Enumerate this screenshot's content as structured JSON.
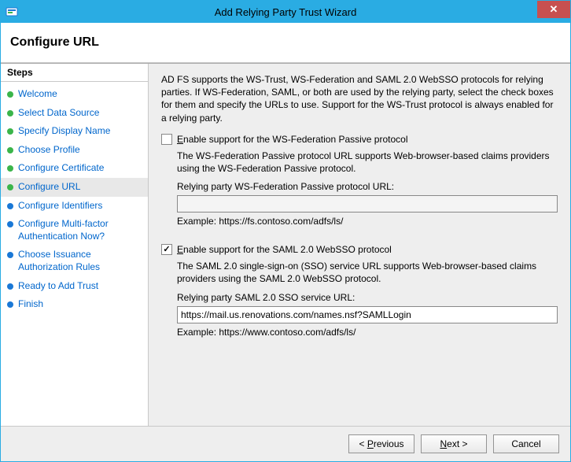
{
  "window": {
    "title": "Add Relying Party Trust Wizard"
  },
  "page": {
    "heading": "Configure URL"
  },
  "steps": {
    "header": "Steps",
    "items": [
      {
        "label": "Welcome",
        "state": "done"
      },
      {
        "label": "Select Data Source",
        "state": "done"
      },
      {
        "label": "Specify Display Name",
        "state": "done"
      },
      {
        "label": "Choose Profile",
        "state": "done"
      },
      {
        "label": "Configure Certificate",
        "state": "done"
      },
      {
        "label": "Configure URL",
        "state": "done",
        "current": true
      },
      {
        "label": "Configure Identifiers",
        "state": "pending"
      },
      {
        "label": "Configure Multi-factor Authentication Now?",
        "state": "pending"
      },
      {
        "label": "Choose Issuance Authorization Rules",
        "state": "pending"
      },
      {
        "label": "Ready to Add Trust",
        "state": "pending"
      },
      {
        "label": "Finish",
        "state": "pending"
      }
    ]
  },
  "content": {
    "intro": "AD FS supports the WS-Trust, WS-Federation and SAML 2.0 WebSSO protocols for relying parties.  If WS-Federation, SAML, or both are used by the relying party, select the check boxes for them and specify the URLs to use.  Support for the WS-Trust protocol is always enabled for a relying party.",
    "wsfed": {
      "checkbox_label_pre": "",
      "checkbox_accel": "E",
      "checkbox_label_post": "nable support for the WS-Federation Passive protocol",
      "checked": false,
      "desc": "The WS-Federation Passive protocol URL supports Web-browser-based claims providers using the WS-Federation Passive protocol.",
      "url_label_pre": "Relying party ",
      "url_label_accel": "W",
      "url_label_post": "S-Federation Passive protocol URL:",
      "url_value": "",
      "example": "Example: https://fs.contoso.com/adfs/ls/"
    },
    "saml": {
      "checkbox_accel": "E",
      "checkbox_label_post": "nable support for the SAML 2.0 WebSSO protocol",
      "checked": true,
      "desc": "The SAML 2.0 single-sign-on (SSO) service URL supports Web-browser-based claims providers using the SAML 2.0 WebSSO protocol.",
      "url_label_pre": "Relying party ",
      "url_label_accel": "S",
      "url_label_post": "AML 2.0 SSO service URL:",
      "url_value": "https://mail.us.renovations.com/names.nsf?SAMLLogin",
      "example": "Example: https://www.contoso.com/adfs/ls/"
    }
  },
  "footer": {
    "previous_pre": "< ",
    "previous_accel": "P",
    "previous_post": "revious",
    "next_accel": "N",
    "next_post": "ext >",
    "cancel": "Cancel"
  }
}
